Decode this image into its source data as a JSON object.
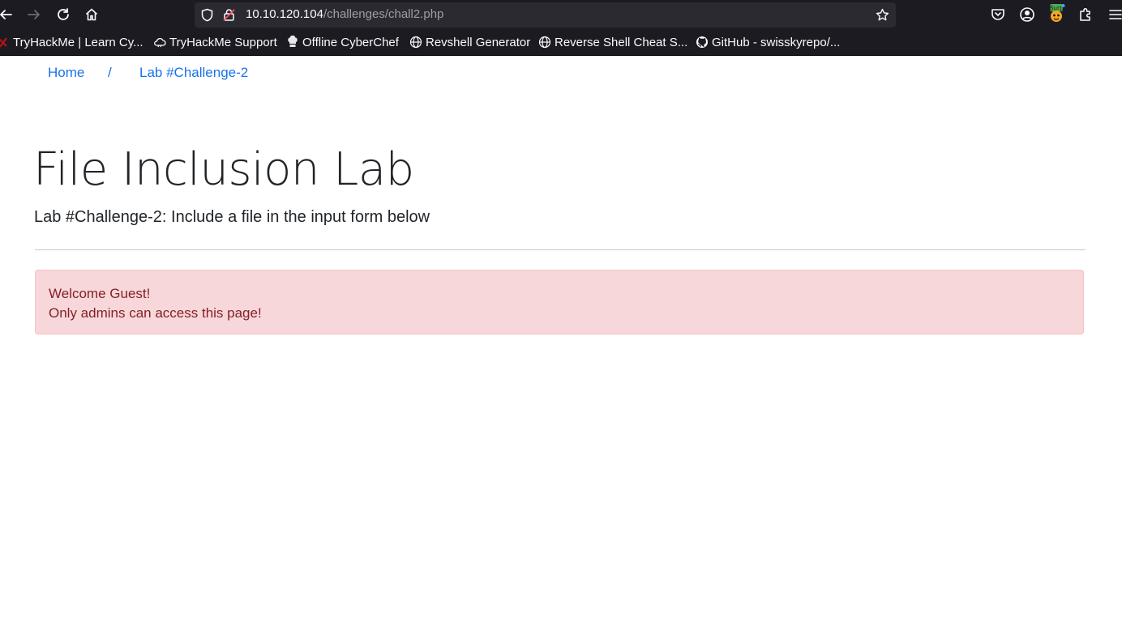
{
  "browser": {
    "url_host": "10.10.120.104",
    "url_path": "/challenges/chall2.php",
    "bookmarks": [
      {
        "label": "TryHackMe | Learn Cy...",
        "icon": "tryhackme-icon"
      },
      {
        "label": "TryHackMe Support",
        "icon": "cloud-icon"
      },
      {
        "label": "Offline CyberChef",
        "icon": "chef-hat-icon"
      },
      {
        "label": "Revshell Generator",
        "icon": "globe-icon"
      },
      {
        "label": "Reverse Shell Cheat S...",
        "icon": "globe-icon"
      },
      {
        "label": "GitHub - swisskyrepo/...",
        "icon": "github-icon"
      }
    ]
  },
  "breadcrumb": {
    "home": "Home",
    "separator": "/",
    "current": "Lab #Challenge-2"
  },
  "page": {
    "title": "File Inclusion Lab",
    "lead": "Lab #Challenge-2: Include a file in the input form below"
  },
  "alert": {
    "line1": "Welcome Guest!",
    "line2": "Only admins can access this page!"
  },
  "colors": {
    "browser_bg": "#1c1b22",
    "urlbar_bg": "#2b2a33",
    "link": "#1a73e8",
    "alert_bg": "#f8d7da",
    "alert_text": "#842029"
  }
}
